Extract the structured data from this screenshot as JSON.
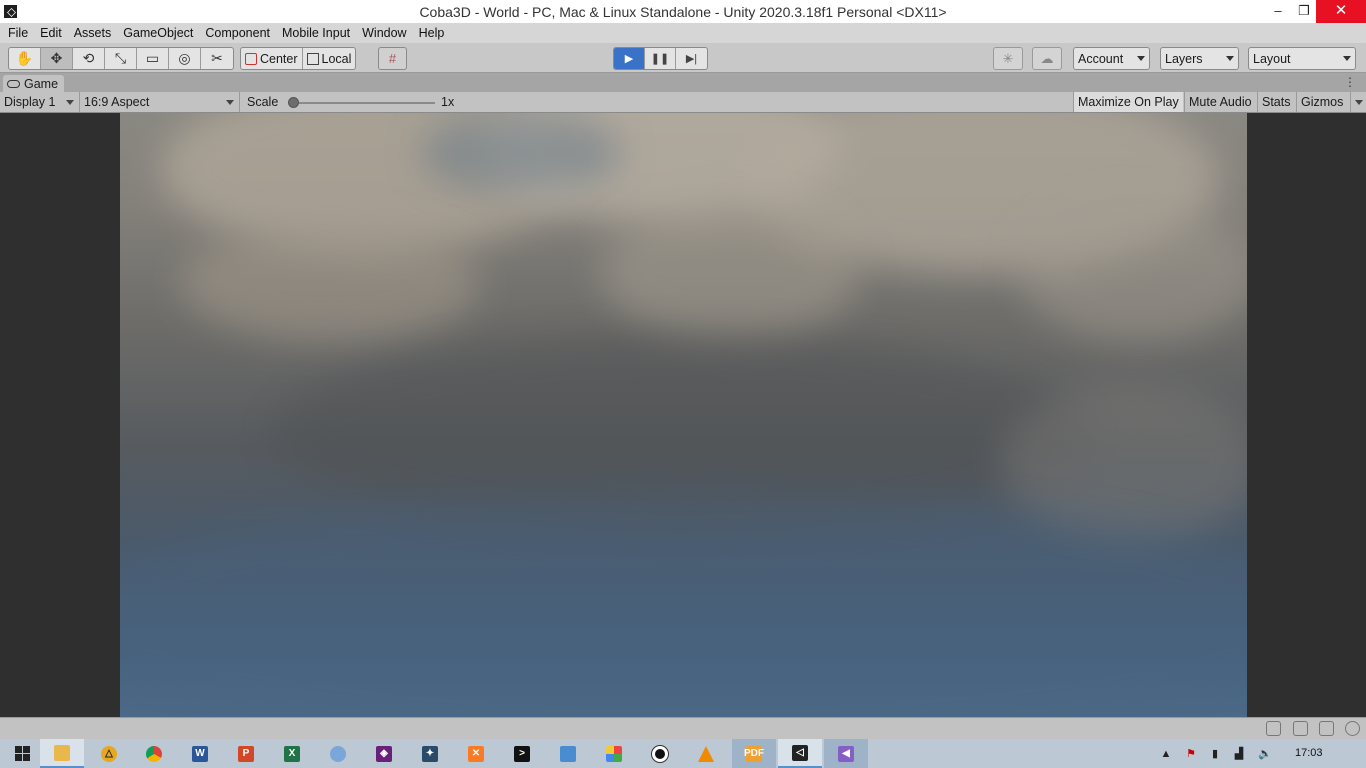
{
  "window": {
    "title": "Coba3D - World - PC, Mac & Linux Standalone - Unity 2020.3.18f1 Personal <DX11>",
    "minimize": "–",
    "maximize": "❐",
    "close": "✕"
  },
  "menu": [
    "File",
    "Edit",
    "Assets",
    "GameObject",
    "Component",
    "Mobile Input",
    "Window",
    "Help"
  ],
  "toolbar": {
    "tools": [
      "hand-tool-icon",
      "move-tool-icon",
      "rotate-tool-icon",
      "scale-tool-icon",
      "rect-tool-icon",
      "transform-tool-icon",
      "custom-tool-icon"
    ],
    "active_tool": "move-tool-icon",
    "pivot_label": "Center",
    "rotation_label": "Local",
    "play_state": "playing",
    "account_label": "Account",
    "layers_label": "Layers",
    "layout_label": "Layout"
  },
  "game_tab": {
    "label": "Game"
  },
  "game_bar": {
    "display": "Display 1",
    "aspect": "16:9 Aspect",
    "scale_label": "Scale",
    "scale_value": "1x",
    "maximize": "Maximize On Play",
    "mute": "Mute Audio",
    "stats": "Stats",
    "gizmos": "Gizmos"
  },
  "taskbar": {
    "apps": [
      "start-icon",
      "file-explorer-icon",
      "autocad-icon",
      "chrome-icon",
      "word-icon",
      "powerpoint-icon",
      "excel-icon",
      "paint-icon",
      "visual-studio-code-icon",
      "terminal-app-icon",
      "xampp-icon",
      "command-prompt-icon",
      "remote-desktop-icon",
      "photos-icon",
      "obs-record-icon",
      "vlc-icon",
      "pdf-reader-icon",
      "unity-icon",
      "visual-studio-icon"
    ],
    "clock": "17:03"
  },
  "colors": {
    "play_active": "#3a72c8",
    "close_button": "#e81123",
    "editor_gray": "#c2c2c2"
  }
}
